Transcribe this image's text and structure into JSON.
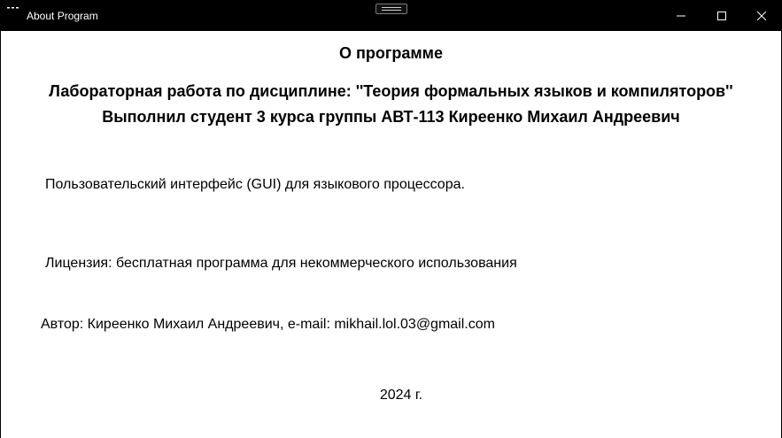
{
  "window": {
    "title": "About Program",
    "icon": "app-icon",
    "controls": {
      "minimize_icon": "minimize-icon",
      "maximize_icon": "maximize-icon",
      "close_icon": "close-icon"
    }
  },
  "about": {
    "heading": "О программе",
    "subject_line": "Лабораторная работа по дисциплине: ''Теория формальных языков и компиляторов''",
    "student_line": "Выполнил студент 3 курса группы АВТ-113 Киреенко Михаил Андреевич",
    "description": "Пользовательский интерфейс (GUI) для языкового процессора.",
    "license": "Лицензия: бесплатная программа для некоммерческого использования",
    "author": "Автор: Киреенко Михаил Андреевич, e-mail: mikhail.lol.03@gmail.com",
    "year": "2024 г."
  },
  "colors": {
    "titlebar_bg": "#000000",
    "titlebar_fg": "#ffffff",
    "content_bg": "#ffffff",
    "text": "#000000"
  }
}
